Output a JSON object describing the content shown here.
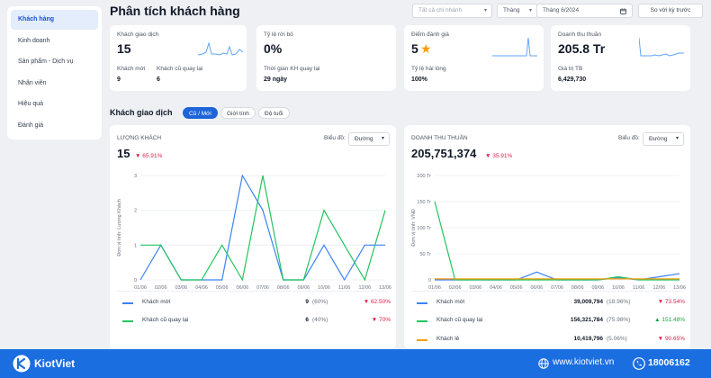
{
  "sidebar": {
    "items": [
      {
        "label": "Khách hàng",
        "active": true
      },
      {
        "label": "Kinh doanh"
      },
      {
        "label": "Sản phẩm - Dịch vụ"
      },
      {
        "label": "Nhân viên"
      },
      {
        "label": "Hiệu quả"
      },
      {
        "label": "Đánh giá"
      }
    ]
  },
  "header": {
    "title": "Phân tích khách hàng",
    "branch_placeholder": "Tất cả chi nhánh",
    "period_value": "Tháng",
    "month_value": "Tháng 6/2024",
    "compare_label": "So với kỳ trước"
  },
  "kpis": {
    "transactions": {
      "label": "Khách giao dịch",
      "value": "15",
      "new_label": "Khách mới",
      "new_value": "9",
      "old_label": "Khách cũ quay lại",
      "old_value": "6"
    },
    "churn": {
      "label": "Tỷ lệ rời bỏ",
      "value": "0%",
      "return_label": "Thời gian KH quay lại",
      "return_value": "29 ngày"
    },
    "rating": {
      "label": "Điểm đánh giá",
      "value": "5",
      "sat_label": "Tỷ lệ hài lòng",
      "sat_value": "100%"
    },
    "revenue": {
      "label": "Doanh thu thuần",
      "value": "205.8 Tr",
      "avg_label": "Giá trị TB",
      "avg_value": "6,429,730"
    }
  },
  "section": {
    "title": "Khách giao dịch",
    "tabs": [
      "Cũ / Mới",
      "Giới tính",
      "Độ tuổi"
    ]
  },
  "left_chart": {
    "heading": "LƯỢNG KHÁCH",
    "value": "15",
    "change": "▼ 65.91%",
    "type_label": "Biểu đồ:",
    "type_value": "Đường",
    "ylabel": "Đơn vị tính: Lượng Khách",
    "legend": [
      {
        "name": "Khách mới",
        "value": "9",
        "pct": "(60%)",
        "change": "▼ 62.50%",
        "dir": "down"
      },
      {
        "name": "Khách cũ quay lại",
        "value": "6",
        "pct": "(40%)",
        "change": "▼ 70%",
        "dir": "down"
      }
    ]
  },
  "right_chart": {
    "heading": "DOANH THU THUẦN",
    "value": "205,751,374",
    "change": "▼ 35.91%",
    "type_label": "Biểu đồ:",
    "type_value": "Đường",
    "ylabel": "Đơn vị tính: VNĐ",
    "legend": [
      {
        "name": "Khách mới",
        "value": "39,009,794",
        "pct": "(18.96%)",
        "change": "▼ 73.54%",
        "dir": "down"
      },
      {
        "name": "Khách cũ quay lại",
        "value": "156,321,784",
        "pct": "(75.98%)",
        "change": "▲ 151.48%",
        "dir": "up"
      },
      {
        "name": "Khách lẻ",
        "value": "10,419,796",
        "pct": "(5.06%)",
        "change": "▼ 90.65%",
        "dir": "down"
      }
    ]
  },
  "chart_data": [
    {
      "type": "line",
      "x": [
        "01/06",
        "02/06",
        "03/06",
        "04/06",
        "05/06",
        "06/06",
        "07/06",
        "08/06",
        "09/06",
        "10/06",
        "11/06",
        "12/06",
        "13/06"
      ],
      "ylim": [
        0,
        3
      ],
      "yticks": [
        "0",
        "1",
        "2",
        "3"
      ],
      "ylabel": "Đơn vị tính: Lượng Khách",
      "series": [
        {
          "name": "Khách mới",
          "color": "#3b82f6",
          "values": [
            0,
            1,
            0,
            0,
            0,
            3,
            2,
            0,
            0,
            1,
            0,
            1,
            1
          ]
        },
        {
          "name": "Khách cũ quay lại",
          "color": "#22c55e",
          "values": [
            1,
            1,
            0,
            0,
            1,
            0,
            3,
            0,
            0,
            2,
            1,
            0,
            2
          ]
        }
      ]
    },
    {
      "type": "line",
      "x": [
        "01/06",
        "02/06",
        "03/06",
        "04/06",
        "05/06",
        "06/06",
        "07/06",
        "08/06",
        "09/06",
        "10/06",
        "11/06",
        "12/06",
        "13/06"
      ],
      "ylim": [
        0,
        200
      ],
      "yticks": [
        "0",
        "50 Tr",
        "100 Tr",
        "150 Tr",
        "200 Tr"
      ],
      "ylabel": "Đơn vị tính: VNĐ",
      "series": [
        {
          "name": "Khách mới",
          "color": "#3b82f6",
          "values": [
            0,
            0,
            0,
            0,
            0,
            15,
            0,
            0,
            0,
            4,
            0,
            6,
            12
          ]
        },
        {
          "name": "Khách cũ quay lại",
          "color": "#22c55e",
          "values": [
            150,
            0,
            0,
            0,
            0,
            0,
            0,
            0,
            0,
            6,
            0,
            0,
            0
          ]
        },
        {
          "name": "Khách lẻ",
          "color": "#f59e0b",
          "values": [
            2,
            2,
            2,
            2,
            2,
            2,
            2,
            2,
            2,
            2,
            2,
            2,
            2
          ]
        }
      ]
    }
  ],
  "footer": {
    "brand": "KiotViet",
    "website": "www.kiotviet.vn",
    "hotline": "18006162"
  }
}
